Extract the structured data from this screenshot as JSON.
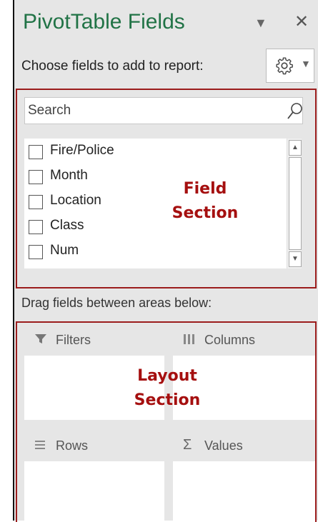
{
  "panel": {
    "title": "PivotTable Fields",
    "choose_label": "Choose fields to add to report:",
    "search_placeholder": "Search",
    "fields": [
      "Fire/Police",
      "Month",
      "Location",
      "Class",
      "Num"
    ],
    "drag_label": "Drag fields between areas below:",
    "areas": {
      "filters": "Filters",
      "columns": "Columns",
      "rows": "Rows",
      "values": "Values"
    }
  },
  "annotations": {
    "field_line1": "Field",
    "field_line2": "Section",
    "layout_line1": "Layout",
    "layout_line2": "Section"
  },
  "colors": {
    "title": "#217346",
    "annotation": "#a50f0f",
    "section_border": "#9b1c1c"
  }
}
